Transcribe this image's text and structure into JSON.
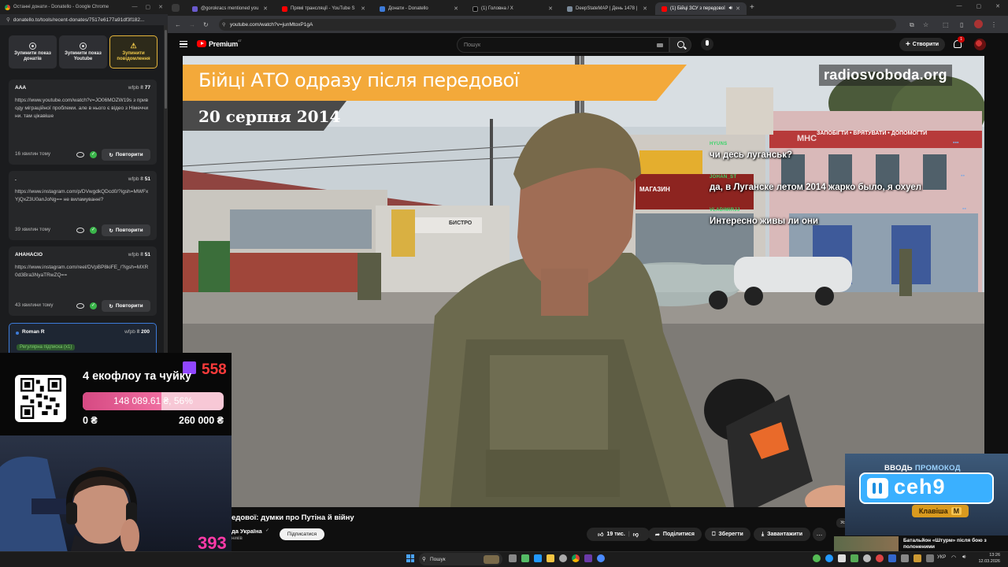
{
  "left_window": {
    "title": "Останні донати - Donatello - Google Chrome",
    "url": "donatello.to/tools/recent-donates/7517e6177a91df3f182..."
  },
  "controls": [
    {
      "label": "Зупинити показ донатів"
    },
    {
      "label": "Зупинити показ Youtube"
    },
    {
      "label": "Зупинити повідомлення"
    }
  ],
  "donations": [
    {
      "name": "AAA",
      "currency_label": "wfpb",
      "amount": "77",
      "message": "https://www.youtube.com/watch?v=JO06MOZW19s з приводу міграційної проблеми. але в нього є відео з Німеччини. там цікавіше",
      "time": "16 хвилин тому",
      "repeat_label": "Повторити"
    },
    {
      "name": ".",
      "currency_label": "wfpb",
      "amount": "51",
      "message": "https://www.instagram.com/p/DVwgdkQDcd0/?igsh=MWFxYjQxZ3U0anJoNg== не виламуванні?",
      "time": "39 хвилин тому",
      "repeat_label": "Повторити"
    },
    {
      "name": "AHAHACIO",
      "currency_label": "wfpb",
      "amount": "51",
      "message": "https://www.instagram.com/reel/DVpBP8kiFE_/?igsh=MXR0d3Bra3NyaTRwZQ==",
      "time": "43 хвилини тому",
      "repeat_label": "Повторити"
    },
    {
      "name": "Roman R",
      "currency_label": "wfpb",
      "amount": "200",
      "badge": "Регулярна підписка (x1)"
    }
  ],
  "browser": {
    "tabs": [
      {
        "label": "@gorokracs mentioned you",
        "color": "#6a5acd"
      },
      {
        "label": "Прямі трансляції - YouTube S",
        "color": "#ff0000"
      },
      {
        "label": "Донати - Donatello",
        "color": "#3d7bd9"
      },
      {
        "label": "(1) Головна / X",
        "color": "#000000"
      },
      {
        "label": "DeepStateMAP | День 1478 |",
        "color": "#7a8a9a"
      },
      {
        "label": "(1) Бійці ЗСУ з передової",
        "color": "#ff0000"
      }
    ],
    "url": "youtube.com/watch?v=junMtoxP1gA"
  },
  "youtube": {
    "logo_text": "Premium",
    "logo_region": "AT",
    "search_placeholder": "Пошук",
    "create_label": "Створити",
    "notif_count": "1"
  },
  "video": {
    "banner_title": "Бійці АТО одразу після передової",
    "banner_date": "20 серпня 2014",
    "watermark": "radiosvoboda.org",
    "sign_top": "МНС",
    "sign_text": "ЗАПОБІГТИ • ВРЯТУВАТИ • ДОПОМОГТИ",
    "shop_sign": "МАГАЗИН",
    "bistro_sign": "БИСТРО"
  },
  "chat": [
    {
      "user": "HYUNS",
      "text": "чи десь луганськ?"
    },
    {
      "user": "JOHAN_ST",
      "text": "да, в Луганске летом 2014 жарко было, я охуел"
    },
    {
      "user": "VLADIMIRJJ",
      "text": "Интересно живы ли они"
    }
  ],
  "goal": {
    "title": "4 екофлоу та чуйку",
    "count": "558",
    "progress_text": "148 089.61 ₴, 56%",
    "progress_fraction": 0.56,
    "min": "0 ₴",
    "max": "260 000 ₴"
  },
  "webcam": {
    "count": "393"
  },
  "under_video": {
    "title": "едової: думки про Путіна й війну",
    "channel": "да Україна",
    "subs": "ників",
    "subscribe": "Підписатися",
    "likes": "19 тис.",
    "share": "Поділитися",
    "save": "Зберегти",
    "download": "Завантажити",
    "partial_btn": "Ус"
  },
  "promo": {
    "title_white": "ВВОДЬ",
    "title_blue": "ПРОМОКОД",
    "code": "ceh9",
    "key_label": "Клавіша",
    "key": "M"
  },
  "next_video": {
    "title": "Батальйон «Штурм» після бою з полоненими"
  },
  "taskbar": {
    "search": "Пошук",
    "lang": "УКР",
    "time": "13:26",
    "date": "12.03.2026"
  }
}
